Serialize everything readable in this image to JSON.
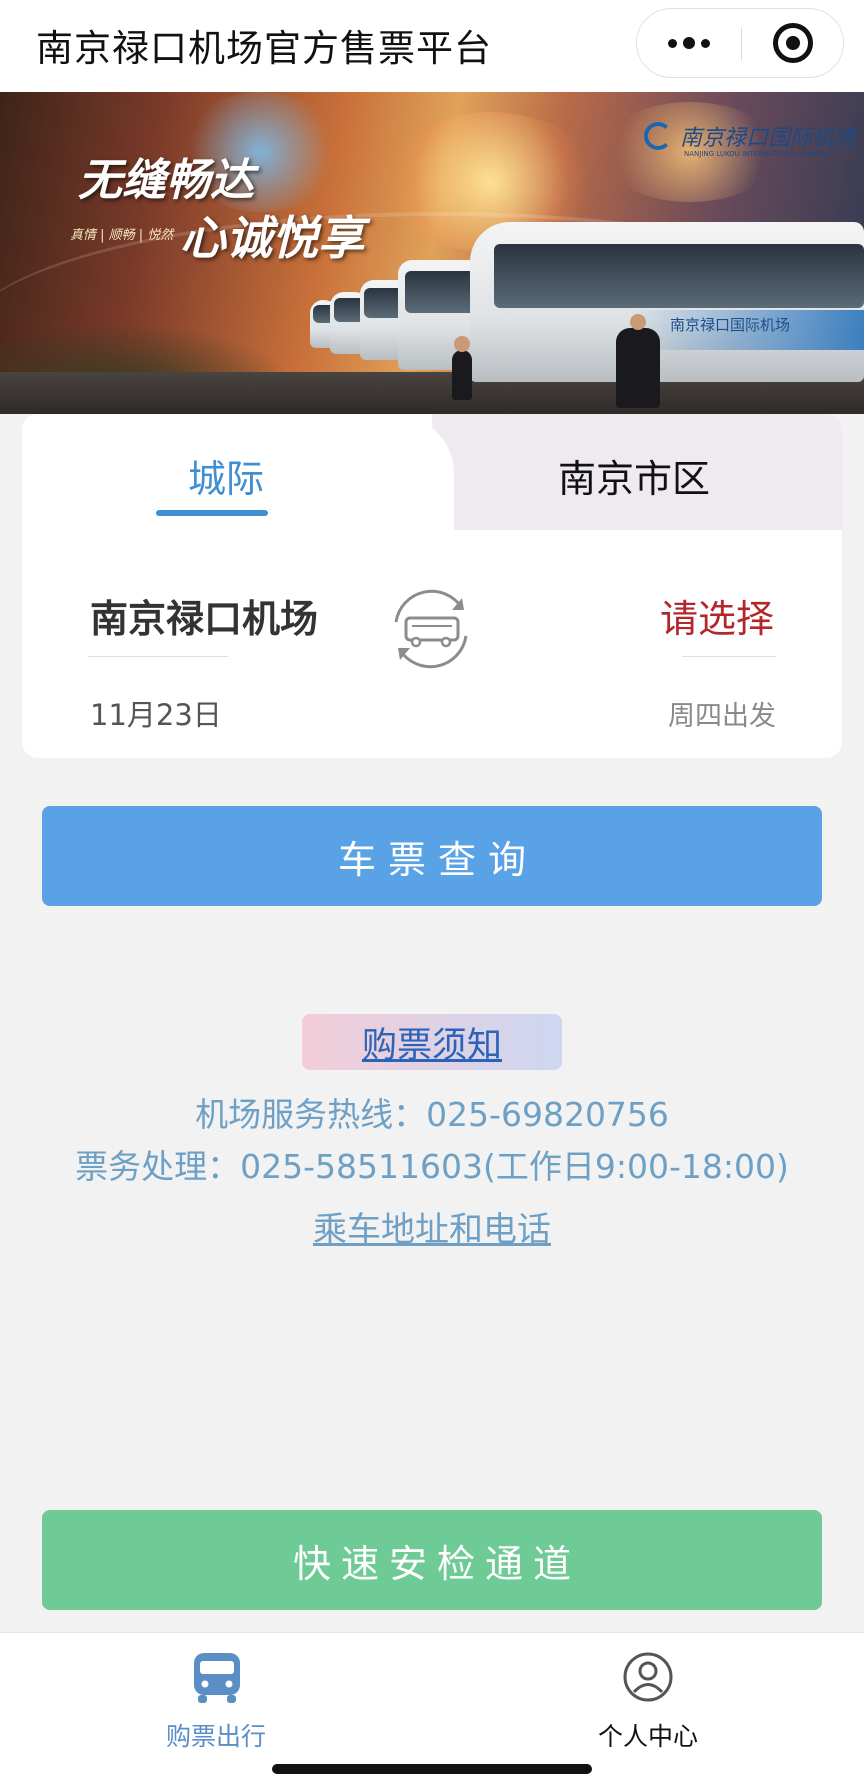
{
  "app": {
    "title": "南京禄口机场官方售票平台"
  },
  "banner": {
    "slogan_line1": "无缝畅达",
    "slogan_line2": "心诚悦享",
    "slogan_small": "真情 | 顺畅 | 悦然",
    "airport_name": "南京禄口国际机场",
    "airport_name_en": "NANJING LUKOU INTERNATIONAL AIRPORT"
  },
  "search": {
    "tabs": [
      {
        "label": "城际",
        "active": true
      },
      {
        "label": "南京市区",
        "active": false
      }
    ],
    "from": "南京禄口机场",
    "to": "请选择",
    "date": "11月23日",
    "weekday": "周四出发"
  },
  "buttons": {
    "query": "车票查询",
    "fast_security": "快速安检通道"
  },
  "info": {
    "notice": "购票须知",
    "hotline": "机场服务热线：025-69820756",
    "ticket_service": "票务处理：025-58511603(工作日9:00-18:00)",
    "address_link": "乘车地址和电话"
  },
  "bottom_nav": {
    "items": [
      {
        "label": "购票出行",
        "icon": "bus-icon",
        "active": true
      },
      {
        "label": "个人中心",
        "icon": "user-icon",
        "active": false
      }
    ]
  },
  "colors": {
    "accent_blue": "#5aa2e6",
    "tab_active": "#3f8fd2",
    "destination_red": "#b3262a",
    "fast_green": "#6fcb96",
    "info_text": "#6ea0c6"
  }
}
